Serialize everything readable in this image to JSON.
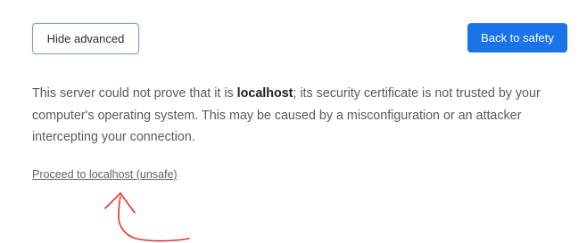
{
  "buttons": {
    "hide_advanced": "Hide advanced",
    "back_to_safety": "Back to safety"
  },
  "details": {
    "text_before": "This server could not prove that it is ",
    "host": "localhost",
    "text_after": "; its security certificate is not trusted by your computer's operating system. This may be caused by a misconfiguration or an attacker intercepting your connection."
  },
  "proceed_link": "Proceed to localhost (unsafe)",
  "colors": {
    "primary": "#1a73e8",
    "annotation": "#e3342f",
    "text": "#5a5a5a"
  },
  "annotation": {
    "icon": "hand-drawn-arrow-icon"
  }
}
